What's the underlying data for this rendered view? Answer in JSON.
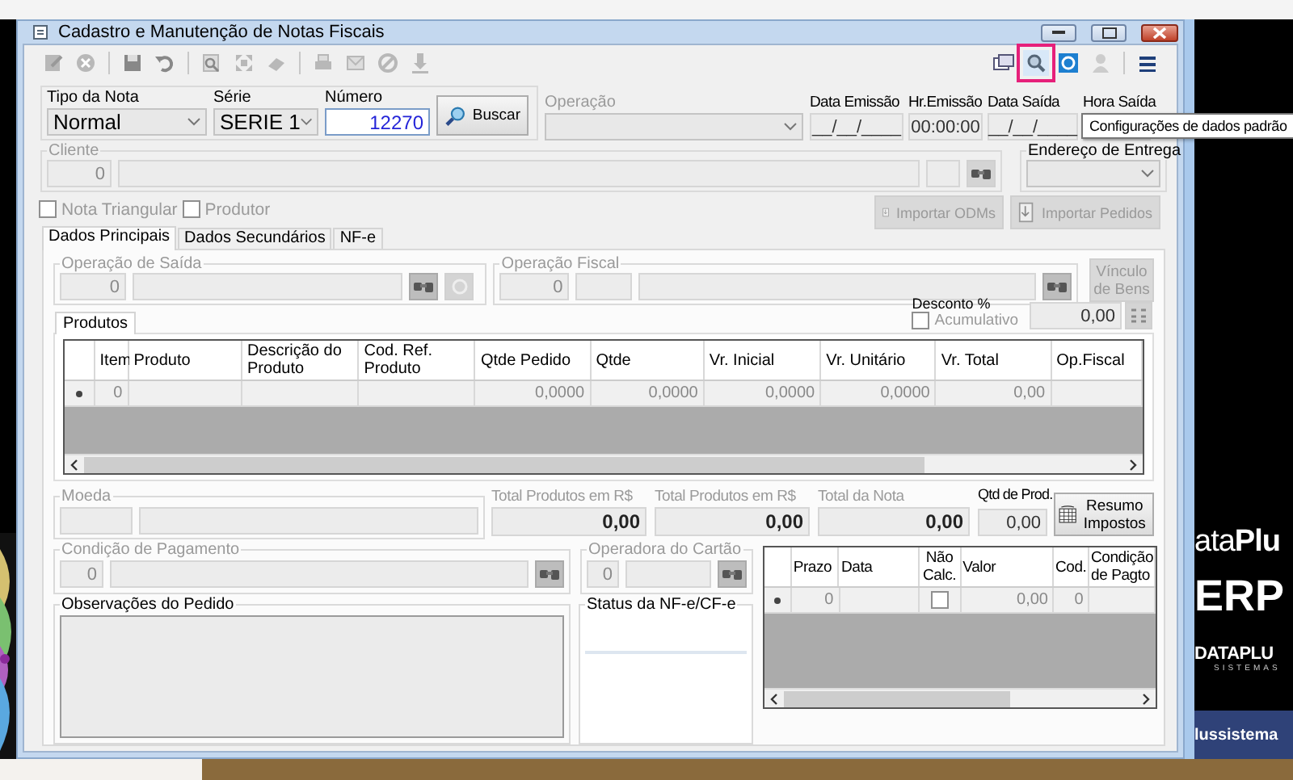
{
  "window": {
    "title": "Cadastro e Manutenção de Notas Fiscais"
  },
  "toolbar": {
    "tooltip": "Configurações de dados padrão"
  },
  "header": {
    "tipo_da_nota": {
      "label": "Tipo da Nota",
      "value": "Normal"
    },
    "serie": {
      "label": "Série",
      "value": "SERIE 1"
    },
    "numero": {
      "label": "Número",
      "value": "12270"
    },
    "buscar_button": {
      "label": "Buscar",
      "disabled": false
    },
    "operacao": {
      "label": "Operação",
      "disabled": true
    },
    "dates": [
      {
        "label": "Data Emissão",
        "value": "__/__/____"
      },
      {
        "label": "Hr.Emissão",
        "value": "00:00:00"
      },
      {
        "label": "Data Saída",
        "value": "__/__/____"
      },
      {
        "label": "Hora Saída"
      }
    ]
  },
  "cliente": {
    "label": "Cliente",
    "code": "0",
    "disabled": true
  },
  "endereco_de_entrega": {
    "label": "Endereço de Entrega",
    "disabled": false
  },
  "options": [
    {
      "label": "Nota Triangular",
      "checked": false,
      "disabled": true
    },
    {
      "label": "Produtor",
      "checked": false,
      "disabled": true
    }
  ],
  "import_buttons": [
    {
      "label": "Importar ODMs",
      "disabled": true
    },
    {
      "label": "Importar Pedidos",
      "disabled": true
    }
  ],
  "tabs": [
    {
      "label": "Dados Principais",
      "selected": true
    },
    {
      "label": "Dados Secundários",
      "selected": false
    },
    {
      "label": "NF-e",
      "selected": false
    }
  ],
  "operacao_de_saida": {
    "label": "Operação de Saída",
    "code": "0",
    "disabled": true
  },
  "operacao_fiscal": {
    "label": "Operação Fiscal",
    "code": "0",
    "disabled": true
  },
  "vinculo_button": {
    "label": "Vínculo de Bens",
    "disabled": true
  },
  "products": {
    "tab": "Produtos",
    "desconto": {
      "label": "Desconto %",
      "checkbox_label": "Acumulativo",
      "checked": false,
      "value": "0,00"
    },
    "columns": [
      "Item",
      "Produto",
      "Descrição do Produto",
      "Cod. Ref. Produto",
      "Qtde Pedido",
      "Qtde",
      "Vr. Inicial",
      "Vr. Unitário",
      "Vr. Total",
      "Op.Fiscal"
    ],
    "rows": [
      {
        "cells": [
          "0",
          null,
          null,
          null,
          "0,0000",
          "0,0000",
          "0,0000",
          "0,0000",
          "0,00",
          null
        ]
      }
    ]
  },
  "moeda": {
    "label": "Moeda",
    "disabled": true
  },
  "totals": {
    "items": [
      {
        "label": "Total Produtos em R$",
        "value": "0,00",
        "disabled": true
      },
      {
        "label": "Total Produtos em R$",
        "value": "0,00",
        "disabled": true
      },
      {
        "label": "Total da Nota",
        "value": "0,00",
        "disabled": true
      },
      {
        "label": "Qtd de Prod.",
        "value": "0,00",
        "disabled": false
      }
    ],
    "resumo_button": {
      "label": "Resumo Impostos",
      "disabled": false
    }
  },
  "condicao_de_pagamento": {
    "label": "Condição de Pagamento",
    "code": "0",
    "disabled": true
  },
  "operadora_do_cartao": {
    "label": "Operadora do Cartão",
    "code": "0",
    "disabled": true
  },
  "observacoes": {
    "label": "Observações do Pedido",
    "disabled": false
  },
  "status": {
    "label": "Status da NF-e/CF-e",
    "disabled": false
  },
  "payments": {
    "columns": [
      "Prazo",
      "Data",
      "Não Calc.",
      "Valor",
      "Cod.",
      "Condição de Pagto"
    ],
    "rows": [
      {
        "cells": [
          "0",
          null,
          null,
          "0,00",
          "0",
          null
        ],
        "nao_calc": false
      }
    ]
  },
  "wallpaper": {
    "brand": "ata**Plu**",
    "product": "ERP",
    "company": "DATAPLU",
    "tagline": "SISTEMAS",
    "site": "lussistema"
  }
}
